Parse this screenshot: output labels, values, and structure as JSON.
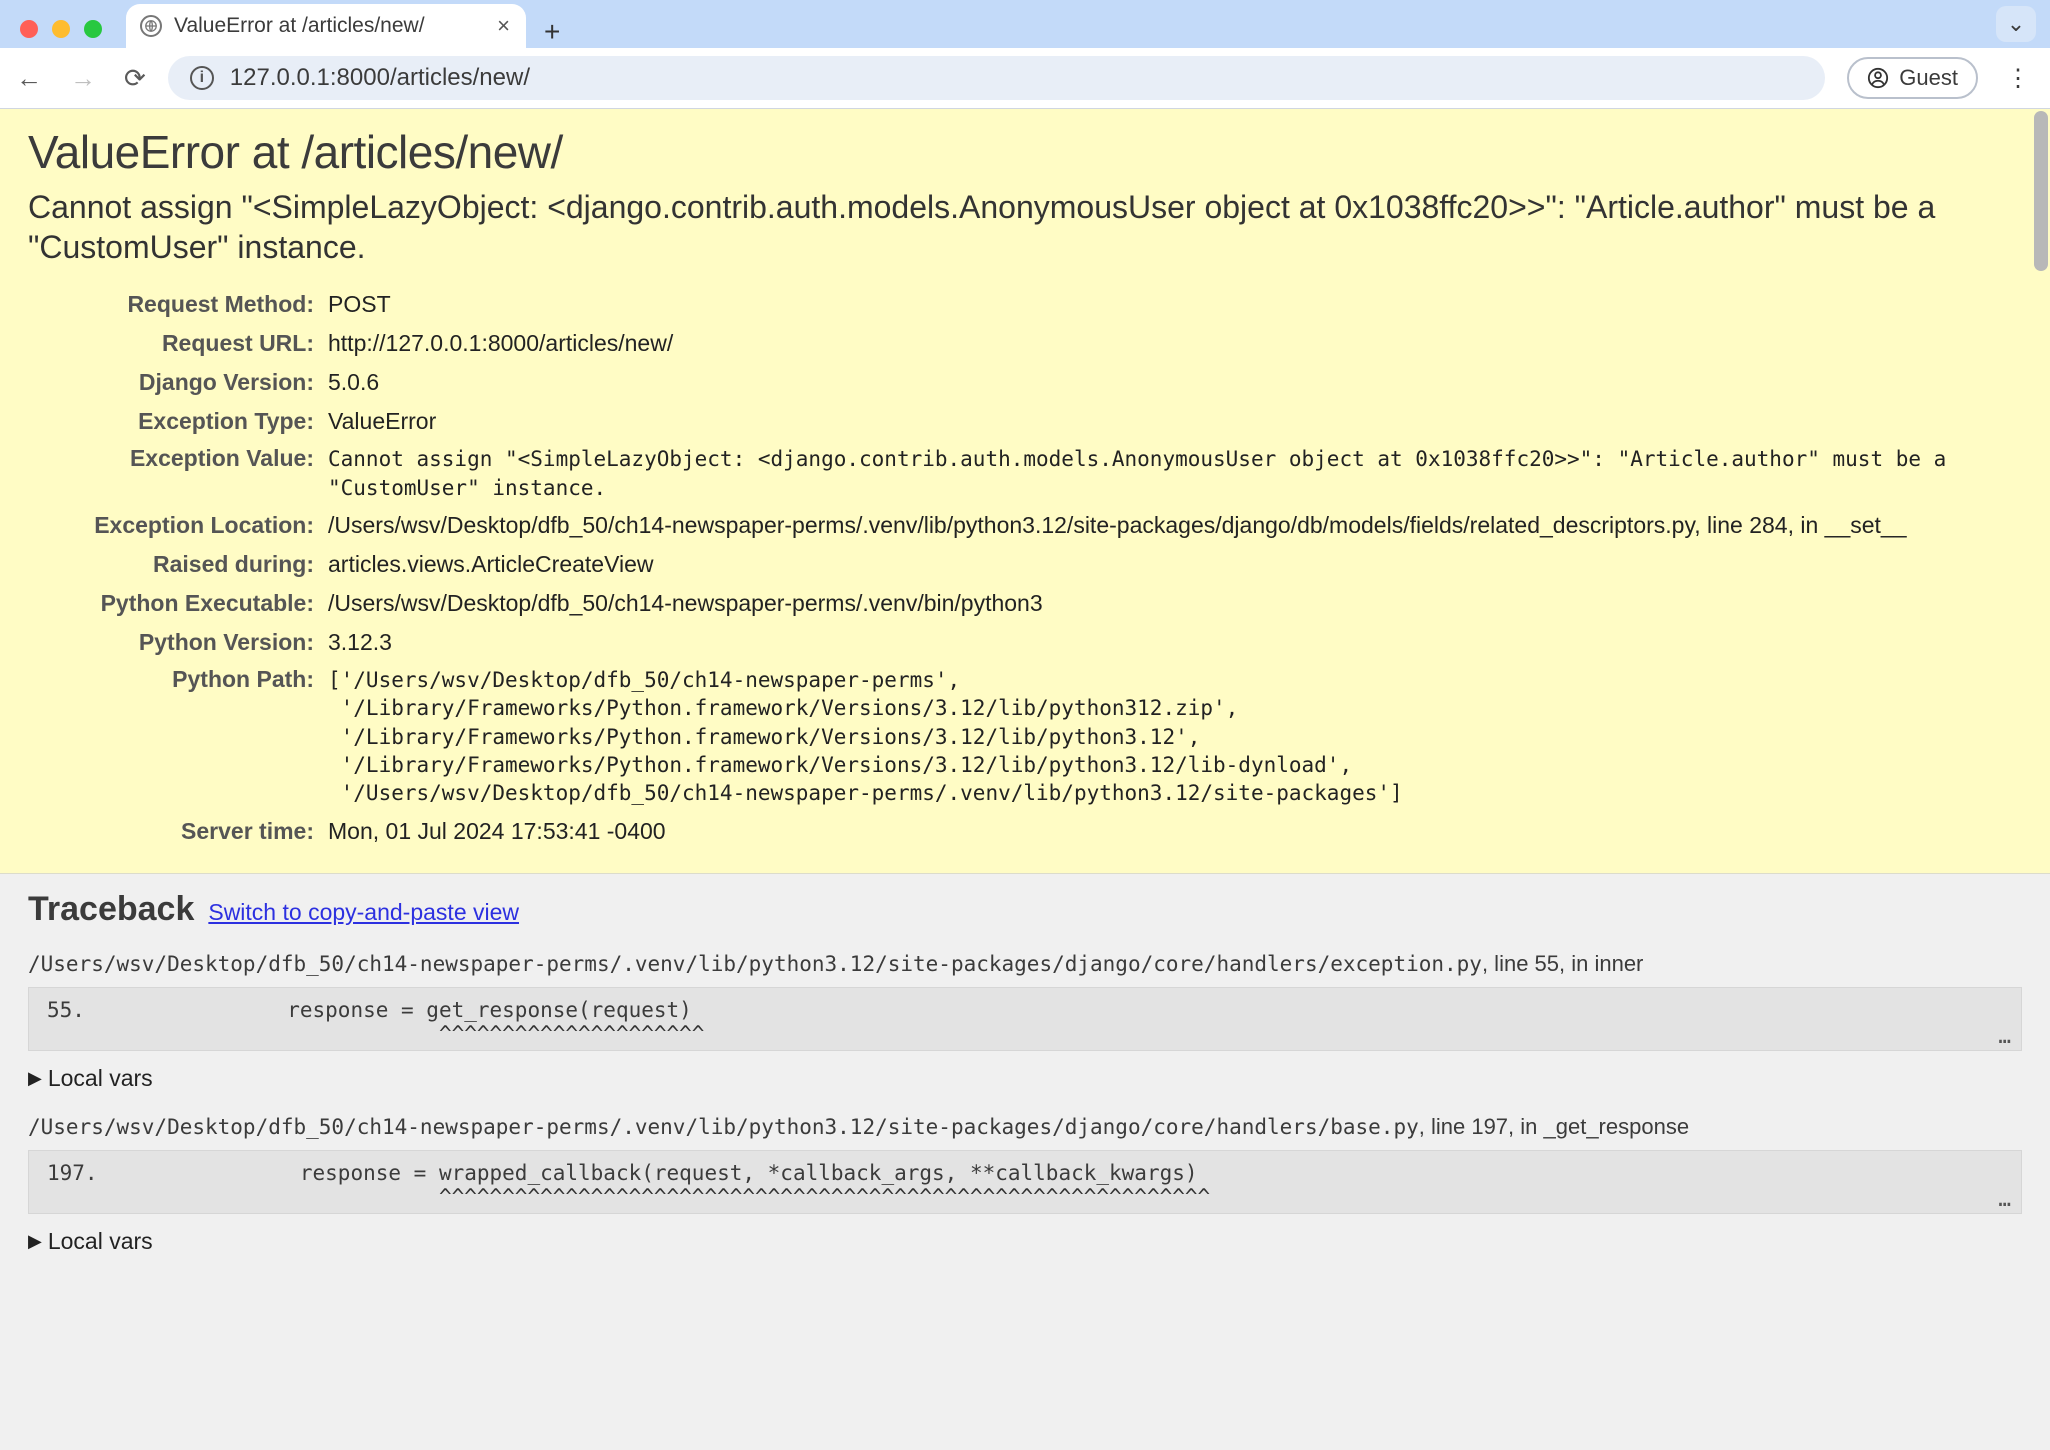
{
  "browser": {
    "tab_title": "ValueError at /articles/new/",
    "url": "127.0.0.1:8000/articles/new/",
    "guest_label": "Guest"
  },
  "error": {
    "title": "ValueError at /articles/new/",
    "subtitle": "Cannot assign \"<SimpleLazyObject: <django.contrib.auth.models.AnonymousUser object at 0x1038ffc20>>\": \"Article.author\" must be a \"CustomUser\" instance."
  },
  "meta": {
    "request_method": {
      "label": "Request Method:",
      "value": "POST"
    },
    "request_url": {
      "label": "Request URL:",
      "value": "http://127.0.0.1:8000/articles/new/"
    },
    "django_version": {
      "label": "Django Version:",
      "value": "5.0.6"
    },
    "exception_type": {
      "label": "Exception Type:",
      "value": "ValueError"
    },
    "exception_value": {
      "label": "Exception Value:",
      "value": "Cannot assign \"<SimpleLazyObject: <django.contrib.auth.models.AnonymousUser object at 0x1038ffc20>>\": \"Article.author\" must be a \"CustomUser\" instance."
    },
    "exception_loc": {
      "label": "Exception Location:",
      "value": "/Users/wsv/Desktop/dfb_50/ch14-newspaper-perms/.venv/lib/python3.12/site-packages/django/db/models/fields/related_descriptors.py, line 284, in __set__"
    },
    "raised_during": {
      "label": "Raised during:",
      "value": "articles.views.ArticleCreateView"
    },
    "py_exec": {
      "label": "Python Executable:",
      "value": "/Users/wsv/Desktop/dfb_50/ch14-newspaper-perms/.venv/bin/python3"
    },
    "py_version": {
      "label": "Python Version:",
      "value": "3.12.3"
    },
    "py_path": {
      "label": "Python Path:",
      "value": "['/Users/wsv/Desktop/dfb_50/ch14-newspaper-perms',\n '/Library/Frameworks/Python.framework/Versions/3.12/lib/python312.zip',\n '/Library/Frameworks/Python.framework/Versions/3.12/lib/python3.12',\n '/Library/Frameworks/Python.framework/Versions/3.12/lib/python3.12/lib-dynload',\n '/Users/wsv/Desktop/dfb_50/ch14-newspaper-perms/.venv/lib/python3.12/site-packages']"
    },
    "server_time": {
      "label": "Server time:",
      "value": "Mon, 01 Jul 2024 17:53:41 -0400"
    }
  },
  "traceback": {
    "heading": "Traceback",
    "switch_link": "Switch to copy-and-paste view",
    "local_vars_label": "Local vars",
    "ellipsis": "…",
    "frames": [
      {
        "path": "/Users/wsv/Desktop/dfb_50/ch14-newspaper-perms/.venv/lib/python3.12/site-packages/django/core/handlers/exception.py",
        "suffix": ", line 55, in inner",
        "lineno": "55.",
        "code": "                response = get_response(request)",
        "carets": "                           ^^^^^^^^^^^^^^^^^^^^^"
      },
      {
        "path": "/Users/wsv/Desktop/dfb_50/ch14-newspaper-perms/.venv/lib/python3.12/site-packages/django/core/handlers/base.py",
        "suffix": ", line 197, in _get_response",
        "lineno": "197.",
        "code": "                response = wrapped_callback(request, *callback_args, **callback_kwargs)",
        "carets": "                           ^^^^^^^^^^^^^^^^^^^^^^^^^^^^^^^^^^^^^^^^^^^^^^^^^^^^^^^^^^^^^"
      }
    ]
  }
}
